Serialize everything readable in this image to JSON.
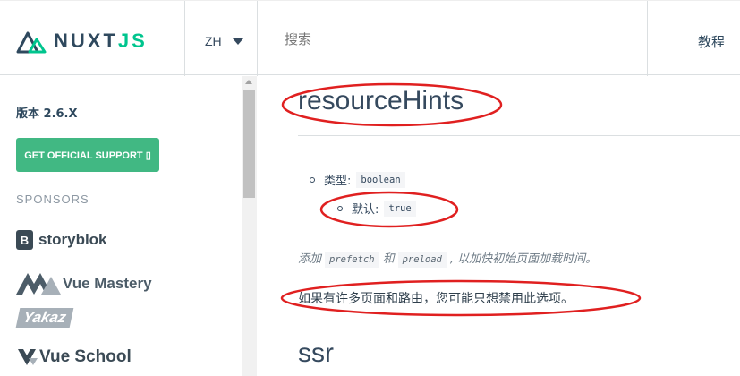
{
  "header": {
    "logo_main": "NUXT",
    "logo_js": "JS",
    "language": "ZH",
    "search_placeholder": "搜索",
    "nav_tutorial": "教程"
  },
  "sidebar": {
    "version": "版本 2.6.X",
    "support_button": "GET OFFICIAL SUPPORT ▯",
    "sponsors_title": "SPONSORS",
    "sponsors": [
      "storyblok",
      "Vue Mastery",
      "Yakaz",
      "Vue School"
    ]
  },
  "main": {
    "title": "resourceHints",
    "type_label": "类型:",
    "type_value": "boolean",
    "default_label": "默认:",
    "default_value": "true",
    "note_prefix": "添加",
    "note_code1": "prefetch",
    "note_and": "和",
    "note_code2": "preload",
    "note_suffix": ", 以加快初始页面加载时间。",
    "paragraph": "如果有许多页面和路由，您可能只想禁用此选项。",
    "next_title": "ssr"
  },
  "colors": {
    "accent": "#41b883",
    "logo_green": "#00c58e",
    "annotation": "#e02020"
  }
}
